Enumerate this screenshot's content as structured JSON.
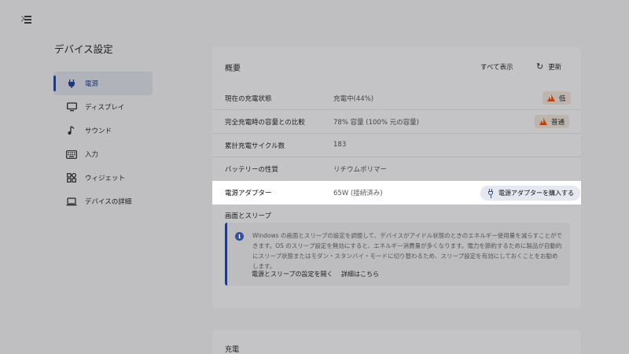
{
  "page": {
    "title": "デバイス設定"
  },
  "sidebar": {
    "items": [
      {
        "label": "電源",
        "icon": "power-plug-icon"
      },
      {
        "label": "ディスプレイ",
        "icon": "monitor-icon"
      },
      {
        "label": "サウンド",
        "icon": "music-note-icon"
      },
      {
        "label": "入力",
        "icon": "keyboard-icon"
      },
      {
        "label": "ウィジェット",
        "icon": "widgets-icon"
      },
      {
        "label": "デバイスの詳細",
        "icon": "laptop-icon"
      }
    ]
  },
  "overview": {
    "title": "概要",
    "show_all": "すべて表示",
    "refresh": "更新",
    "rows": [
      {
        "label": "現在の充電状態",
        "value": "充電中(44%)",
        "badge": "低"
      },
      {
        "label": "完全充電時の容量との比較",
        "value": "78% 容量 (100% 元の容量)",
        "badge": "普通"
      },
      {
        "label": "累計充電サイクル数",
        "value": "183"
      },
      {
        "label": "バッテリーの性質",
        "value": "リチウムポリマー"
      }
    ],
    "adapter": {
      "label": "電源アダプター",
      "value": "65W (接続済み)",
      "button": "電源アダプターを購入する"
    },
    "screen_sleep": {
      "title": "画面とスリープ",
      "info": "Windows の画面とスリープの設定を調整して、デバイスがアイドル状態のときのエネルギー使用量を減らすことができます。OS のスリープ設定を無効にすると、エネルギー消費量が多くなります。電力を節約するために製品が自動的にスリープ状態またはモダン・スタンバイ・モードに切り替わるため、スリープ設定を有効にしておくことをお勧めします。",
      "link_open": "電源とスリープの設定を開く",
      "link_more": "詳細はこちら"
    }
  },
  "charging": {
    "title": "充電"
  },
  "colors": {
    "accent": "#1e3a7a",
    "warning": "#c2410c"
  }
}
